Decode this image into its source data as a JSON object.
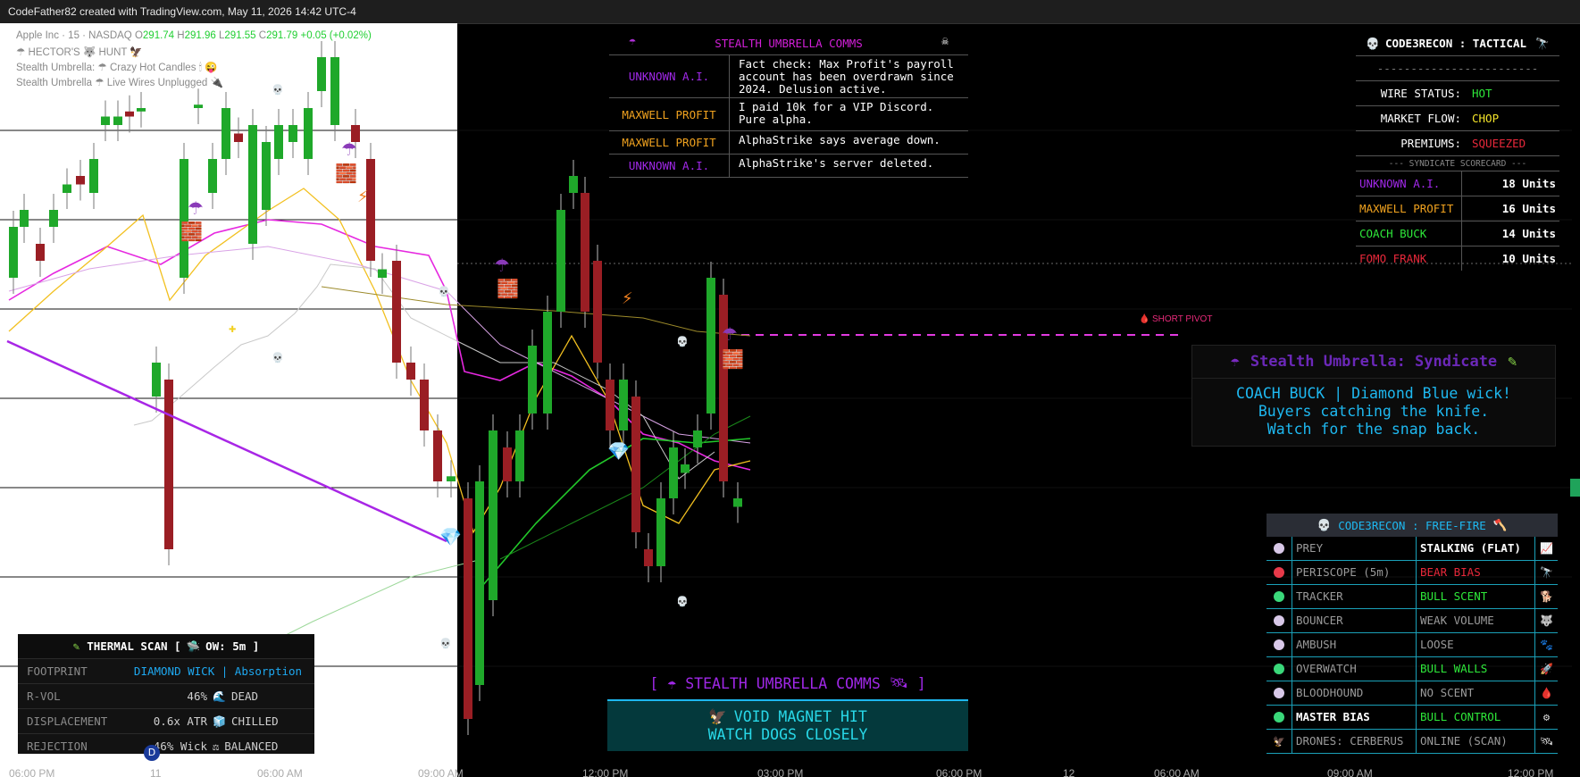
{
  "header": {
    "attribution": "CodeFather82 created with TradingView.com, May 11, 2026 14:42 UTC-4"
  },
  "legend": {
    "symbol": "Apple Inc · 15 · NASDAQ",
    "ohlc": {
      "o_label": "O",
      "o": "291.74",
      "h_label": "H",
      "h": "291.96",
      "l_label": "L",
      "l": "291.55",
      "c_label": "C",
      "c": "291.79",
      "change": "+0.05 (+0.02%)"
    },
    "indicators": [
      {
        "name": "HECTOR'S",
        "suffix": "HUNT"
      },
      {
        "name": "Stealth Umbrella:",
        "suffix": "Crazy Hot Candles"
      },
      {
        "name": "Stealth Umbrella",
        "suffix": "Live Wires Unplugged"
      }
    ]
  },
  "comms": {
    "title": "STEALTH UMBRELLA COMMS",
    "rows": [
      {
        "who": "UNKNOWN A.I.",
        "color": "#a028e8",
        "msg": "Fact check: Max Profit's payroll account has been overdrawn since 2024. Delusion active."
      },
      {
        "who": "MAXWELL PROFIT",
        "color": "#f0a21f",
        "msg": "I paid 10k for a VIP Discord. Pure alpha."
      },
      {
        "who": "MAXWELL PROFIT",
        "color": "#f0a21f",
        "msg": "AlphaStrike says average down."
      },
      {
        "who": "UNKNOWN A.I.",
        "color": "#a028e8",
        "msg": "AlphaStrike's server deleted."
      }
    ]
  },
  "tactical": {
    "title": "CODE3RECON : TACTICAL",
    "divider": "------------------------",
    "status": [
      {
        "label": "WIRE STATUS:",
        "value": "HOT",
        "color": "#2ee83a"
      },
      {
        "label": "MARKET FLOW:",
        "value": "CHOP",
        "color": "#f5e52a"
      },
      {
        "label": "PREMIUMS:",
        "value": "SQUEEZED",
        "color": "#e8283a"
      }
    ],
    "scorecard_title": "--- SYNDICATE SCORECARD ---",
    "scores": [
      {
        "name": "UNKNOWN A.I.",
        "units": "18 Units",
        "color": "#a028e8"
      },
      {
        "name": "MAXWELL PROFIT",
        "units": "16 Units",
        "color": "#f0a21f"
      },
      {
        "name": "COACH BUCK",
        "units": "14 Units",
        "color": "#2ee83a"
      },
      {
        "name": "FOMO FRANK",
        "units": "10 Units",
        "color": "#e8283a"
      }
    ]
  },
  "pivot": {
    "label": "SHORT PIVOT"
  },
  "syndicate_card": {
    "title": "Stealth Umbrella: Syndicate",
    "line1": "COACH BUCK | Diamond Blue wick!",
    "line2": "Buyers catching the knife.",
    "line3": "Watch for the snap back."
  },
  "freefire": {
    "title": "CODE3RECON : FREE-FIRE",
    "rows": [
      {
        "label": "PREY",
        "value": "STALKING (FLAT)",
        "dot": "#d8c8e8",
        "vcolor": "#ffffff",
        "icon": "📈"
      },
      {
        "label": "PERISCOPE (5m)",
        "value": "BEAR BIAS",
        "dot": "#e83a4a",
        "vcolor": "#e8283a",
        "icon": "🔭"
      },
      {
        "label": "TRACKER",
        "value": "BULL SCENT",
        "dot": "#3ad87a",
        "vcolor": "#2ee83a",
        "icon": "🐕"
      },
      {
        "label": "BOUNCER",
        "value": "WEAK VOLUME",
        "dot": "#d8c8e8",
        "vcolor": "#9a9a9a",
        "icon": "🐺"
      },
      {
        "label": "AMBUSH",
        "value": "LOOSE",
        "dot": "#d8c8e8",
        "vcolor": "#9a9a9a",
        "icon": "🐾"
      },
      {
        "label": "OVERWATCH",
        "value": "BULL WALLS",
        "dot": "#3ad87a",
        "vcolor": "#2ee83a",
        "icon": "🚀"
      },
      {
        "label": "BLOODHOUND",
        "value": "NO SCENT",
        "dot": "#d8c8e8",
        "vcolor": "#9a9a9a",
        "icon": "🩸"
      },
      {
        "label": "MASTER BIAS",
        "value": "BULL CONTROL",
        "dot": "#3ad87a",
        "vcolor": "#2ee83a",
        "icon": "⚙"
      },
      {
        "label": "DRONES: CERBERUS",
        "value": "ONLINE (SCAN)",
        "dot": "",
        "vcolor": "#9a9a9a",
        "icon": "🛰"
      }
    ]
  },
  "thermal": {
    "title": "THERMAL SCAN [",
    "title2": "OW: 5m ]",
    "rows": [
      {
        "label": "FOOTPRINT",
        "value": "DIAMOND WICK | Absorption",
        "vcolor": "#1ea8f0"
      },
      {
        "label": "R-VOL",
        "value": "46%",
        "value2": "DEAD",
        "vcolor": "#cfcfcf"
      },
      {
        "label": "DISPLACEMENT",
        "value": "0.6x ATR",
        "value2": "CHILLED",
        "vcolor": "#cfcfcf"
      },
      {
        "label": "REJECTION",
        "value": "46% Wick",
        "value2": "BALANCED",
        "vcolor": "#cfcfcf"
      }
    ]
  },
  "comms_bottom": {
    "title": "STEALTH UMBRELLA COMMS",
    "line1": "VOID MAGNET HIT",
    "line2": "WATCH DOGS CLOSELY",
    "open_bracket": "[",
    "close_bracket": "]"
  },
  "xaxis": {
    "labels": [
      "06:00 PM",
      "11",
      "06:00 AM",
      "09:00 AM",
      "12:00 PM",
      "03:00 PM",
      "06:00 PM",
      "12",
      "06:00 AM",
      "09:00 AM",
      "12:00 PM"
    ]
  },
  "badges": {
    "d_marker": "D"
  },
  "chart_data": {
    "type": "candlestick",
    "symbol": "AAPL",
    "timeframe": "15",
    "candles": [
      {
        "o": 296,
        "c": 298,
        "dir": "up"
      },
      {
        "o": 297,
        "c": 295,
        "dir": "down"
      },
      {
        "o": 296,
        "c": 298,
        "dir": "up"
      },
      {
        "o": 299,
        "c": 301,
        "dir": "up"
      },
      {
        "o": 300,
        "c": 299,
        "dir": "down"
      },
      {
        "o": 299,
        "c": 303,
        "dir": "up"
      },
      {
        "o": 302,
        "c": 305,
        "dir": "up"
      },
      {
        "o": 305,
        "c": 305.5,
        "dir": "up"
      },
      {
        "o": 305,
        "c": 304,
        "dir": "down"
      },
      {
        "o": 303,
        "c": 308,
        "dir": "up"
      },
      {
        "o": 306,
        "c": 293,
        "dir": "down"
      },
      {
        "o": 294,
        "c": 291,
        "dir": "up"
      },
      {
        "o": 294,
        "c": 300,
        "dir": "up"
      },
      {
        "o": 299,
        "c": 308,
        "dir": "up"
      }
    ]
  }
}
